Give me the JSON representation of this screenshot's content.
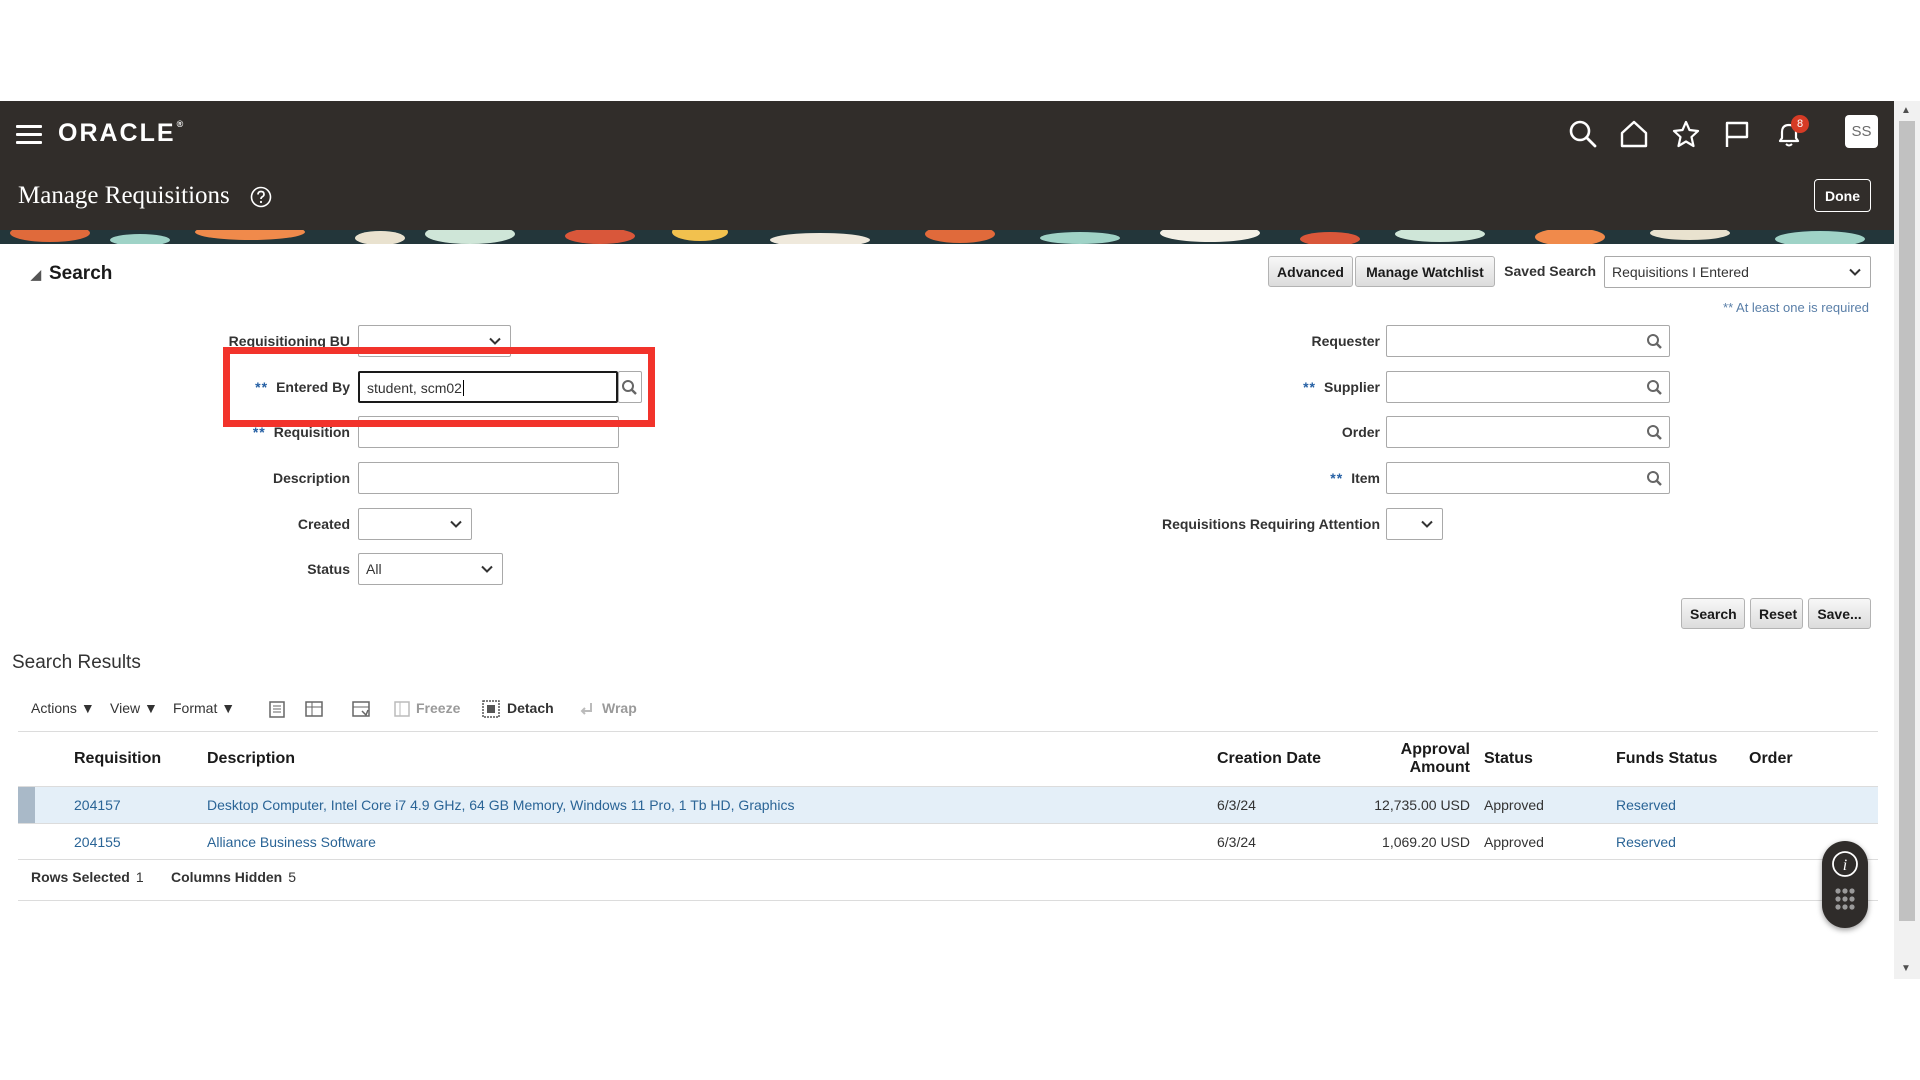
{
  "header": {
    "logo": "ORACLE",
    "logo_mark": "®",
    "notification_count": "8",
    "avatar_initials": "SS",
    "page_title": "Manage Requisitions",
    "done_label": "Done"
  },
  "search": {
    "toggle_label": "Search",
    "advanced_label": "Advanced",
    "manage_watchlist_label": "Manage Watchlist",
    "saved_search_label": "Saved Search",
    "saved_search_value": "Requisitions I Entered",
    "required_note": "** At least one is required",
    "required_marker": "**",
    "fields": {
      "requisitioning_bu": {
        "label": "Requisitioning BU",
        "value": ""
      },
      "entered_by": {
        "label": "Entered By",
        "value": "student, scm02"
      },
      "requisition": {
        "label": "Requisition",
        "value": ""
      },
      "description": {
        "label": "Description",
        "value": ""
      },
      "created": {
        "label": "Created",
        "value": ""
      },
      "status": {
        "label": "Status",
        "value": "All"
      },
      "requester": {
        "label": "Requester",
        "value": ""
      },
      "supplier": {
        "label": "Supplier",
        "value": ""
      },
      "order": {
        "label": "Order",
        "value": ""
      },
      "item": {
        "label": "Item",
        "value": ""
      },
      "requiring_attention": {
        "label": "Requisitions Requiring Attention",
        "value": ""
      }
    },
    "search_button": "Search",
    "reset_button": "Reset",
    "save_button": "Save..."
  },
  "results": {
    "title": "Search Results",
    "toolbar": {
      "actions": "Actions",
      "view": "View",
      "format": "Format",
      "freeze": "Freeze",
      "detach": "Detach",
      "wrap": "Wrap"
    },
    "columns": {
      "requisition": "Requisition",
      "description": "Description",
      "creation_date": "Creation Date",
      "approval_amount_1": "Approval",
      "approval_amount_2": "Amount",
      "status": "Status",
      "funds_status": "Funds Status",
      "order": "Order"
    },
    "rows": [
      {
        "requisition": "204157",
        "description": "Desktop Computer, Intel Core i7 4.9 GHz, 64 GB Memory, Windows 11 Pro, 1 Tb HD, Graphics",
        "creation_date": "6/3/24",
        "amount": "12,735.00",
        "currency": "USD",
        "status": "Approved",
        "funds_status": "Reserved",
        "order": ""
      },
      {
        "requisition": "204155",
        "description": "Alliance Business Software",
        "creation_date": "6/3/24",
        "amount": "1,069.20",
        "currency": "USD",
        "status": "Approved",
        "funds_status": "Reserved",
        "order": ""
      }
    ],
    "footer": {
      "rows_selected_label": "Rows Selected",
      "rows_selected_value": "1",
      "columns_hidden_label": "Columns Hidden",
      "columns_hidden_value": "5"
    }
  },
  "colors": {
    "header_bg": "#312d2a",
    "highlight": "#f2332b",
    "link": "#2a6496",
    "selected_row": "#e4eff8"
  },
  "icons": [
    "menu-icon",
    "search-icon",
    "home-icon",
    "star-icon",
    "flag-icon",
    "bell-icon",
    "help-icon",
    "magnifier-icon",
    "chevron-down-icon"
  ]
}
